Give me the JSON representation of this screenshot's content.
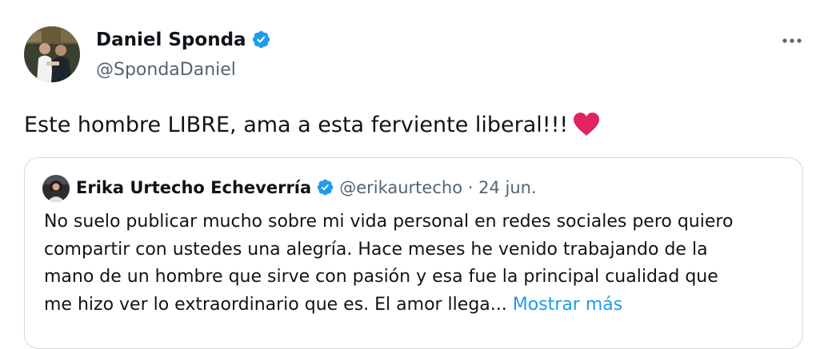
{
  "author": {
    "name": "Daniel Sponda",
    "handle": "@SpondaDaniel",
    "verified_color": "#1d9bf0",
    "avatar": "avatar-photo"
  },
  "tweet": {
    "text": "Este hombre LIBRE, ama a esta ferviente liberal!!!",
    "emoji": "heart-icon",
    "emoji_color": "#e0245e"
  },
  "menu": {
    "icon": "more-icon"
  },
  "quoted": {
    "name": "Erika Urtecho Echeverría",
    "handle": "@erikaurtecho",
    "separator": "·",
    "date": "24 jun.",
    "lines": [
      "No suelo publicar mucho sobre mi vida personal en redes sociales pero quiero",
      "compartir con ustedes una alegría. Hace meses he venido trabajando de la",
      "mano de un hombre que sirve con pasión y esa fue la principal cualidad que",
      "me hizo ver lo extraordinario que es. El amor llega..."
    ],
    "show_more": "Mostrar más"
  },
  "colors": {
    "text": "#0f1419",
    "secondary": "#536471",
    "link": "#1d9bf0",
    "border": "#cfd9de"
  }
}
